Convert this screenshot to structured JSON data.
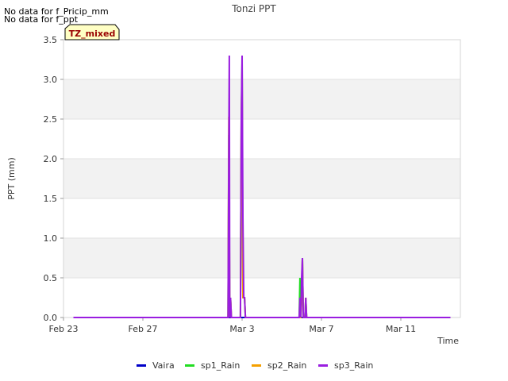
{
  "messages": [
    "No data for f_Pricip_mm",
    "No data for f_ppt"
  ],
  "chart_data": {
    "type": "line",
    "title": "Tonzi PPT",
    "xlabel": "Time",
    "ylabel": "PPT (mm)",
    "badge": "TZ_mixed",
    "ylim": [
      0,
      3.5
    ],
    "yticks": [
      "0.0",
      "0.5",
      "1.0",
      "1.5",
      "2.0",
      "2.5",
      "3.0",
      "3.5"
    ],
    "xlim": [
      "2024-02-23",
      "2024-03-14"
    ],
    "xticks": [
      {
        "date": "2024-02-23",
        "label": "Feb 23"
      },
      {
        "date": "2024-02-27",
        "label": "Feb 27"
      },
      {
        "date": "2024-03-03",
        "label": "Mar 3"
      },
      {
        "date": "2024-03-07",
        "label": "Mar 7"
      },
      {
        "date": "2024-03-11",
        "label": "Mar 11"
      }
    ],
    "grid": true,
    "legend_position": "bottom",
    "series": [
      {
        "name": "Vaira",
        "color": "#0000c8",
        "points": [
          [
            "2024-02-23T12:00",
            0
          ],
          [
            "2024-03-13T12:00",
            0
          ]
        ]
      },
      {
        "name": "sp1_Rain",
        "color": "#22dd22",
        "points": [
          [
            "2024-02-23T12:00",
            0
          ],
          [
            "2024-03-02T07:00",
            0
          ],
          [
            "2024-03-02T08:00",
            2.3
          ],
          [
            "2024-03-02T09:00",
            0
          ],
          [
            "2024-03-02T10:00",
            0.25
          ],
          [
            "2024-03-02T11:00",
            0
          ],
          [
            "2024-03-02T22:00",
            0
          ],
          [
            "2024-03-02T23:00",
            2.5
          ],
          [
            "2024-03-03T00:00",
            3.2
          ],
          [
            "2024-03-03T01:00",
            0.25
          ],
          [
            "2024-03-03T02:00",
            0.25
          ],
          [
            "2024-03-03T03:00",
            0.25
          ],
          [
            "2024-03-03T04:00",
            0
          ],
          [
            "2024-03-05T21:00",
            0
          ],
          [
            "2024-03-05T22:00",
            0.5
          ],
          [
            "2024-03-05T23:00",
            0
          ],
          [
            "2024-03-06T00:00",
            0.25
          ],
          [
            "2024-03-06T01:00",
            0.75
          ],
          [
            "2024-03-06T02:00",
            0
          ],
          [
            "2024-03-06T04:00",
            0
          ],
          [
            "2024-03-06T05:00",
            0.25
          ],
          [
            "2024-03-06T06:00",
            0
          ],
          [
            "2024-03-13T12:00",
            0
          ]
        ]
      },
      {
        "name": "sp2_Rain",
        "color": "#f5a000",
        "points": [
          [
            "2024-02-23T12:00",
            0
          ],
          [
            "2024-03-02T07:00",
            0
          ],
          [
            "2024-03-02T08:00",
            2.53
          ],
          [
            "2024-03-02T09:00",
            0
          ],
          [
            "2024-03-02T10:00",
            0.25
          ],
          [
            "2024-03-02T11:00",
            0
          ],
          [
            "2024-03-02T22:00",
            0
          ],
          [
            "2024-03-02T23:00",
            2.5
          ],
          [
            "2024-03-03T00:00",
            3.1
          ],
          [
            "2024-03-03T01:00",
            0.25
          ],
          [
            "2024-03-03T02:00",
            0.25
          ],
          [
            "2024-03-03T03:00",
            0.25
          ],
          [
            "2024-03-03T04:00",
            0
          ],
          [
            "2024-03-05T23:00",
            0
          ],
          [
            "2024-03-06T00:00",
            0.25
          ],
          [
            "2024-03-06T01:00",
            0.75
          ],
          [
            "2024-03-06T02:00",
            0
          ],
          [
            "2024-03-06T04:00",
            0
          ],
          [
            "2024-03-06T05:00",
            0.25
          ],
          [
            "2024-03-06T06:00",
            0
          ],
          [
            "2024-03-13T12:00",
            0
          ]
        ]
      },
      {
        "name": "sp3_Rain",
        "color": "#9a1ee0",
        "points": [
          [
            "2024-02-23T12:00",
            0
          ],
          [
            "2024-03-02T07:00",
            0
          ],
          [
            "2024-03-02T08:00",
            2.28
          ],
          [
            "2024-03-02T08:30",
            3.3
          ],
          [
            "2024-03-02T09:00",
            0
          ],
          [
            "2024-03-02T10:00",
            0.25
          ],
          [
            "2024-03-02T11:00",
            0
          ],
          [
            "2024-03-02T22:00",
            0
          ],
          [
            "2024-03-02T23:00",
            2.53
          ],
          [
            "2024-03-03T00:00",
            3.3
          ],
          [
            "2024-03-03T01:00",
            1.27
          ],
          [
            "2024-03-03T02:00",
            0.25
          ],
          [
            "2024-03-03T03:00",
            0.25
          ],
          [
            "2024-03-03T04:00",
            0
          ],
          [
            "2024-03-05T21:00",
            0
          ],
          [
            "2024-03-05T22:00",
            0.25
          ],
          [
            "2024-03-05T23:00",
            0
          ],
          [
            "2024-03-06T00:00",
            0.5
          ],
          [
            "2024-03-06T01:00",
            0.75
          ],
          [
            "2024-03-06T02:00",
            0
          ],
          [
            "2024-03-06T04:00",
            0
          ],
          [
            "2024-03-06T05:00",
            0.25
          ],
          [
            "2024-03-06T06:00",
            0
          ],
          [
            "2024-03-13T12:00",
            0
          ]
        ]
      }
    ]
  }
}
